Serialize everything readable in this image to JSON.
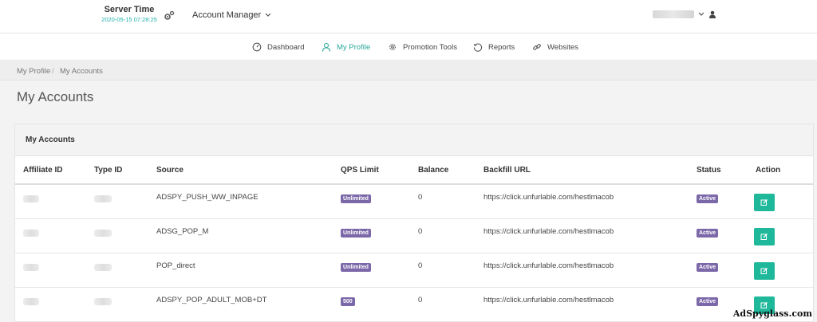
{
  "header": {
    "server_time_label": "Server Time",
    "server_time_value": "2020-05-15 07:28:25",
    "account_manager_label": "Account Manager"
  },
  "nav": {
    "items": [
      {
        "label": "Dashboard",
        "icon": "dashboard-icon"
      },
      {
        "label": "My Profile",
        "icon": "user-icon",
        "active": true
      },
      {
        "label": "Promotion Tools",
        "icon": "gear-icon"
      },
      {
        "label": "Reports",
        "icon": "history-icon"
      },
      {
        "label": "Websites",
        "icon": "link-icon"
      }
    ]
  },
  "breadcrumb": {
    "items": [
      "My Profile",
      "My Accounts"
    ],
    "separator": "/"
  },
  "page_title": "My Accounts",
  "panel": {
    "title": "My Accounts",
    "columns": [
      "Affiliate ID",
      "Type ID",
      "Source",
      "QPS Limit",
      "Balance",
      "Backfill URL",
      "Status",
      "Action"
    ],
    "rows": [
      {
        "source": "ADSPY_PUSH_WW_INPAGE",
        "qps": "Unlimited",
        "balance": "0",
        "url": "https://click.unfurlable.com/hestlmacob",
        "status": "Active"
      },
      {
        "source": "ADSG_POP_M",
        "qps": "Unlimited",
        "balance": "0",
        "url": "https://click.unfurlable.com/hestlmacob",
        "status": "Active"
      },
      {
        "source": "POP_direct",
        "qps": "Unlimited",
        "balance": "0",
        "url": "https://click.unfurlable.com/hestlmacob",
        "status": "Active"
      },
      {
        "source": "ADSPY_POP_ADULT_MOB+DT",
        "qps": "500",
        "balance": "0",
        "url": "https://click.unfurlable.com/hestlmacob",
        "status": "Active"
      }
    ]
  },
  "watermark": "AdSpyglass.com",
  "colors": {
    "accent": "#2aa89b",
    "badge": "#7b68a8",
    "action_button": "#1fb89b"
  }
}
